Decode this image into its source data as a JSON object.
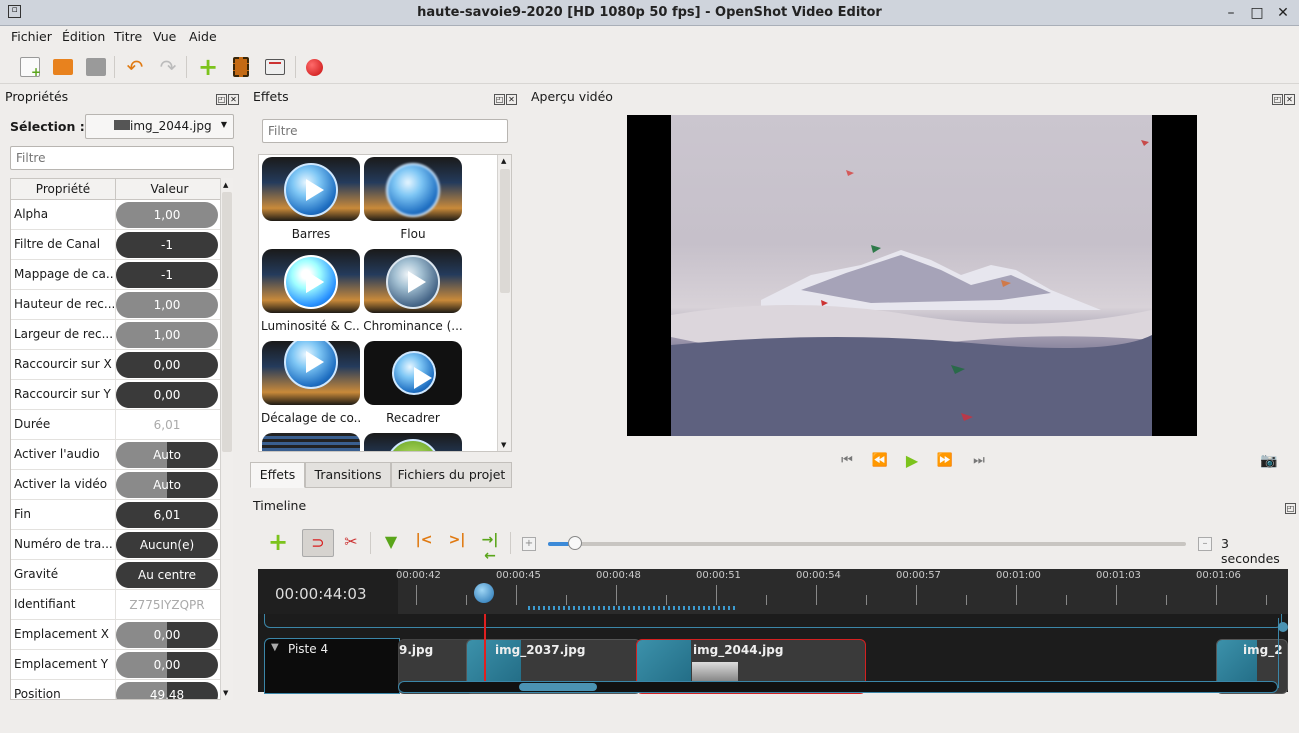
{
  "window": {
    "title": "haute-savoie9-2020 [HD 1080p 50 fps] - OpenShot Video Editor"
  },
  "menu": [
    "Fichier",
    "Édition",
    "Titre",
    "Vue",
    "Aide"
  ],
  "toolbar": {
    "icons": [
      "new-project-icon",
      "open-project-icon",
      "save-project-icon",
      "undo-icon",
      "redo-icon",
      "import-files-icon",
      "profile-icon",
      "fullscreen-icon",
      "record-icon"
    ],
    "accent_colors": {
      "add": "#7cc31c",
      "record": "#d81e1e",
      "undo": "#e07a12"
    }
  },
  "properties": {
    "title": "Propriétés",
    "selection_label": "Sélection :",
    "selection_value": "img_2044.jpg",
    "filter_placeholder": "Filtre",
    "col_property": "Propriété",
    "col_value": "Valeur",
    "rows": [
      {
        "name": "Alpha",
        "value": "1,00",
        "fill": 1.0
      },
      {
        "name": "Filtre de Canal",
        "value": "-1",
        "fill": 0
      },
      {
        "name": "Mappage de ca...",
        "value": "-1",
        "fill": 0
      },
      {
        "name": "Hauteur de rec...",
        "value": "1,00",
        "fill": 1.0
      },
      {
        "name": "Largeur de rec...",
        "value": "1,00",
        "fill": 1.0
      },
      {
        "name": "Raccourcir sur X",
        "value": "0,00",
        "fill": 0
      },
      {
        "name": "Raccourcir sur Y",
        "value": "0,00",
        "fill": 0
      },
      {
        "name": "Durée",
        "value": "6,01",
        "fill": -1
      },
      {
        "name": "Activer l'audio",
        "value": "Auto",
        "fill": 0.5
      },
      {
        "name": "Activer la vidéo",
        "value": "Auto",
        "fill": 0.5
      },
      {
        "name": "Fin",
        "value": "6,01",
        "fill": 0
      },
      {
        "name": "Numéro de tra...",
        "value": "Aucun(e)",
        "fill": 0
      },
      {
        "name": "Gravité",
        "value": "Au centre",
        "fill": 0
      },
      {
        "name": "Identifiant",
        "value": "Z775IYZQPR",
        "fill": -1
      },
      {
        "name": "Emplacement X",
        "value": "0,00",
        "fill": 0.5
      },
      {
        "name": "Emplacement Y",
        "value": "0,00",
        "fill": 0.5
      },
      {
        "name": "Position",
        "value": "49,48",
        "fill": 0.5
      }
    ]
  },
  "effects": {
    "title": "Effets",
    "filter_placeholder": "Filtre",
    "items": [
      "Barres",
      "Flou",
      "Luminosité & C...",
      "Chrominance (...",
      "Décalage de co...",
      "Recadrer"
    ]
  },
  "tabs": [
    "Effets",
    "Transitions",
    "Fichiers du projet"
  ],
  "preview": {
    "title": "Aperçu vidéo"
  },
  "timeline": {
    "title": "Timeline",
    "zoom_label": "3 secondes",
    "current_time": "00:00:44:03",
    "ticks": [
      "00:00:42",
      "00:00:45",
      "00:00:48",
      "00:00:51",
      "00:00:54",
      "00:00:57",
      "00:01:00",
      "00:01:03",
      "00:01:06"
    ],
    "track_name": "Piste 4",
    "clips": [
      "9.jpg",
      "img_2037.jpg",
      "img_2044.jpg",
      "img_2"
    ]
  }
}
